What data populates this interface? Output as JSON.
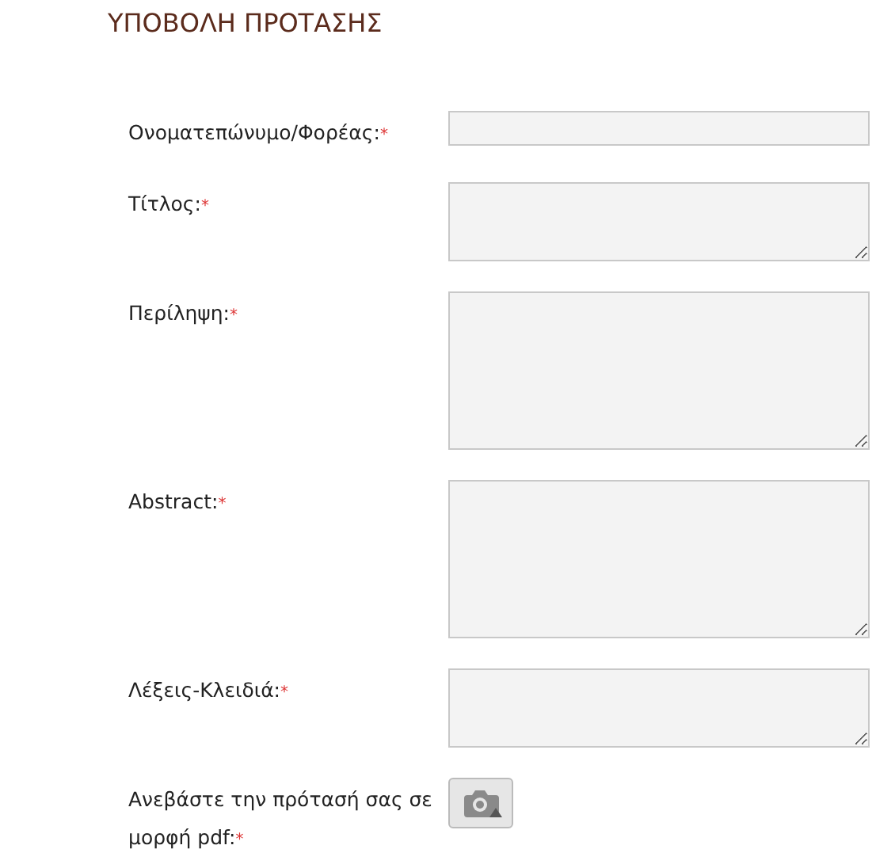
{
  "title": "ΥΠΟΒΟΛΗ ΠΡΟΤΑΣΗΣ",
  "fields": [
    {
      "label": "Ονοματεπώνυμο/Φορέας:",
      "required_mark": "*",
      "kind": "input"
    },
    {
      "label": "Τίτλος:",
      "required_mark": "*",
      "kind": "textarea_small"
    },
    {
      "label": "Περίληψη:",
      "required_mark": "*",
      "kind": "textarea_large"
    },
    {
      "label": "Abstract:",
      "required_mark": "*",
      "kind": "textarea_large"
    },
    {
      "label": "Λέξεις-Κλειδιά:",
      "required_mark": "*",
      "kind": "textarea_small"
    },
    {
      "label": "Ανεβάστε την πρότασή σας σε μορφή pdf:",
      "required_mark": "*",
      "kind": "upload"
    }
  ]
}
